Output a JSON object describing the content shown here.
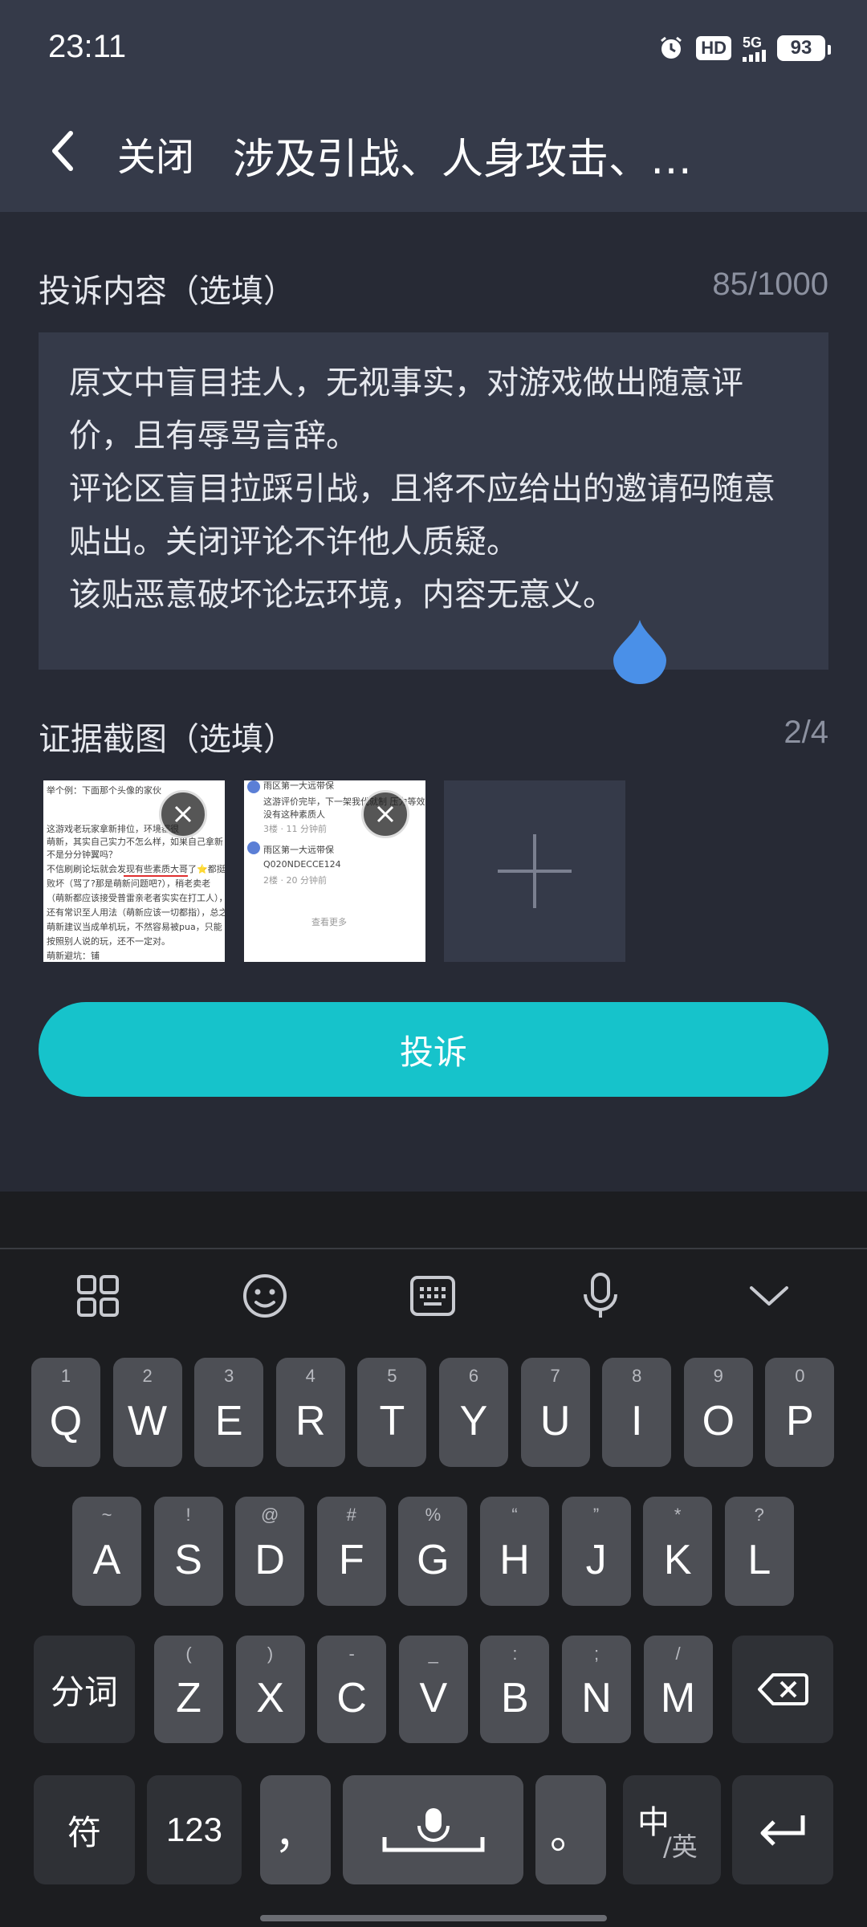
{
  "status_bar": {
    "time": "23:11",
    "hd": "HD",
    "network": "5G",
    "battery": "93"
  },
  "header": {
    "close_label": "关闭",
    "title": "涉及引战、人身攻击、…"
  },
  "form": {
    "content_label": "投诉内容（选填）",
    "char_count": "85/1000",
    "content_text": "原文中盲目挂人，无视事实，对游戏做出随意评价，且有辱骂言辞。\n评论区盲目拉踩引战，且将不应给出的邀请码随意贴出。关闭评论不许他人质疑。\n该贴恶意破坏论坛环境，内容无意义。",
    "evidence_label": "证据截图（选填）",
    "image_count": "2/4",
    "thumb1_lines": [
      "举个例：下面那个头像的家伙",
      "",
      "这游戏老玩家拿新排位，环境都很",
      "萌新，其实自己实力不怎么样，如果自己拿新",
      "不是分分钟翼吗？",
      "不信刷刷论坛就会发现有些素质大哥了⭐都挺",
      "败坏（骂了?那是萌新问题吧?），稍老卖老",
      "（萌新都应该接受普雷亲老者实实在打工人），",
      "还有常识至人用法（萌新应该一切都指），总之",
      "萌新建议当成单机玩，不然容易被pua，只能",
      "按照别人说的玩，还不一定对。",
      "萌新避坑：铺"
    ],
    "thumb2_lines": [
      "雨区第一大远带保",
      "这游评价完毕，下一架我代就制 压力等效",
      "没有这种素质人",
      "3楼 · 11 分钟前",
      "雨区第一大远带保",
      "Q020NDECCE124",
      "2楼 · 20 分钟前",
      "查看更多"
    ],
    "submit_label": "投诉"
  },
  "keyboard": {
    "toolbar": [
      "grid-icon",
      "emoji-icon",
      "keyboard-icon",
      "mic-icon",
      "collapse-icon"
    ],
    "row1": [
      {
        "k": "Q",
        "h": "1"
      },
      {
        "k": "W",
        "h": "2"
      },
      {
        "k": "E",
        "h": "3"
      },
      {
        "k": "R",
        "h": "4"
      },
      {
        "k": "T",
        "h": "5"
      },
      {
        "k": "Y",
        "h": "6"
      },
      {
        "k": "U",
        "h": "7"
      },
      {
        "k": "I",
        "h": "8"
      },
      {
        "k": "O",
        "h": "9"
      },
      {
        "k": "P",
        "h": "0"
      }
    ],
    "row2": [
      {
        "k": "A",
        "h": "~"
      },
      {
        "k": "S",
        "h": "!"
      },
      {
        "k": "D",
        "h": "@"
      },
      {
        "k": "F",
        "h": "#"
      },
      {
        "k": "G",
        "h": "%"
      },
      {
        "k": "H",
        "h": "“"
      },
      {
        "k": "J",
        "h": "”"
      },
      {
        "k": "K",
        "h": "*"
      },
      {
        "k": "L",
        "h": "?"
      }
    ],
    "row3": [
      {
        "k": "Z",
        "h": "("
      },
      {
        "k": "X",
        "h": ")"
      },
      {
        "k": "C",
        "h": "-"
      },
      {
        "k": "V",
        "h": "_"
      },
      {
        "k": "B",
        "h": ":"
      },
      {
        "k": "N",
        "h": ";"
      },
      {
        "k": "M",
        "h": "/"
      }
    ],
    "segment_key": "分词",
    "symbol_key": "符",
    "num_key": "123",
    "comma_key": "，",
    "period_key": "。",
    "lang_key_main": "中",
    "lang_key_sub": "/英"
  }
}
